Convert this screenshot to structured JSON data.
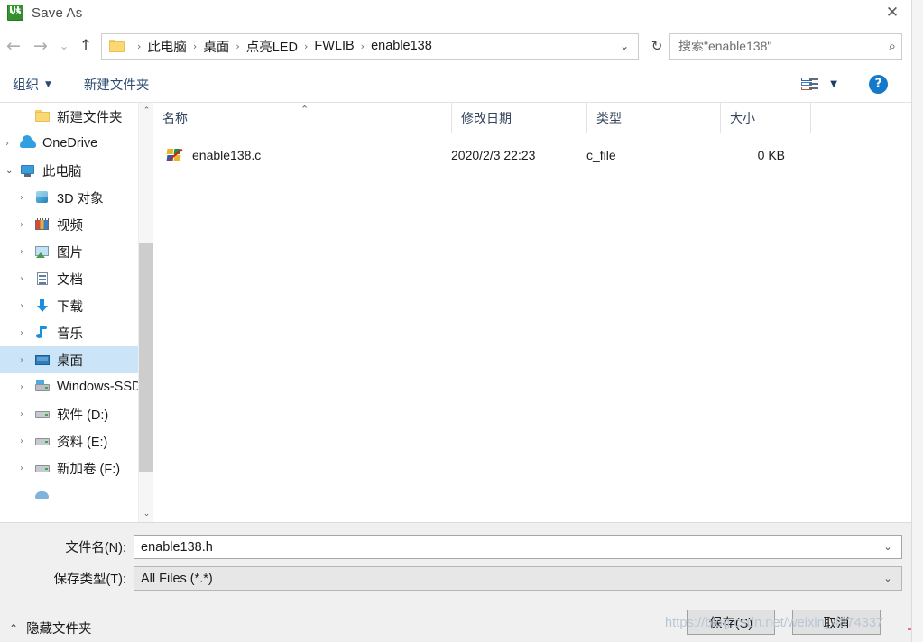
{
  "window": {
    "title": "Save As",
    "app_icon": "keil-uvision5-icon",
    "close_label": "✕"
  },
  "nav": {
    "back_icon": "←",
    "forward_icon": "→",
    "history_icon": "⌄",
    "up_icon": "↑",
    "refresh_icon": "↻",
    "address_chevron": "⌄",
    "breadcrumbs": [
      {
        "label": "此电脑"
      },
      {
        "label": "桌面"
      },
      {
        "label": "点亮LED"
      },
      {
        "label": "FWLIB"
      },
      {
        "label": "enable138"
      }
    ],
    "separator": "›"
  },
  "search": {
    "placeholder": "搜索\"enable138\"",
    "icon": "⌕"
  },
  "toolbar": {
    "organize_label": "组织",
    "organize_caret": "▼",
    "new_folder_label": "新建文件夹",
    "view_caret": "▼",
    "help_label": "?"
  },
  "sidebar": {
    "items": [
      {
        "label": "新建文件夹",
        "chevron": "",
        "icon": "folder-icon",
        "indent": 2,
        "selected": false
      },
      {
        "label": "OneDrive",
        "chevron": "›",
        "icon": "cloud-icon",
        "indent": 1,
        "selected": false
      },
      {
        "label": "此电脑",
        "chevron": "⌄",
        "icon": "pc-icon",
        "indent": 1,
        "selected": false
      },
      {
        "label": "3D 对象",
        "chevron": "›",
        "icon": "3d-objects-icon",
        "indent": 2,
        "selected": false
      },
      {
        "label": "视频",
        "chevron": "›",
        "icon": "video-icon",
        "indent": 2,
        "selected": false
      },
      {
        "label": "图片",
        "chevron": "›",
        "icon": "pictures-icon",
        "indent": 2,
        "selected": false
      },
      {
        "label": "文档",
        "chevron": "›",
        "icon": "documents-icon",
        "indent": 2,
        "selected": false
      },
      {
        "label": "下载",
        "chevron": "›",
        "icon": "downloads-icon",
        "indent": 2,
        "selected": false
      },
      {
        "label": "音乐",
        "chevron": "›",
        "icon": "music-icon",
        "indent": 2,
        "selected": false
      },
      {
        "label": "桌面",
        "chevron": "›",
        "icon": "desktop-icon",
        "indent": 2,
        "selected": true
      },
      {
        "label": "Windows-SSD",
        "chevron": "›",
        "icon": "ssd-drive-icon",
        "indent": 2,
        "selected": false
      },
      {
        "label": "软件 (D:)",
        "chevron": "›",
        "icon": "drive-icon",
        "indent": 2,
        "selected": false
      },
      {
        "label": "资料 (E:)",
        "chevron": "›",
        "icon": "drive-icon",
        "indent": 2,
        "selected": false
      },
      {
        "label": "新加卷 (F:)",
        "chevron": "›",
        "icon": "drive-icon",
        "indent": 2,
        "selected": false
      }
    ],
    "scroll_up_icon": "⌃",
    "scroll_down_icon": "⌄"
  },
  "filelist": {
    "columns": [
      {
        "key": "name",
        "label": "名称"
      },
      {
        "key": "date",
        "label": "修改日期"
      },
      {
        "key": "type",
        "label": "类型"
      },
      {
        "key": "size",
        "label": "大小"
      }
    ],
    "sort_caret": "⌃",
    "rows": [
      {
        "name": "enable138.c",
        "date": "2020/2/3 22:23",
        "type": "c_file",
        "size": "0 KB",
        "icon": "c-source-file-icon"
      }
    ]
  },
  "form": {
    "filename_label": "文件名(N):",
    "filename_value": "enable138.h",
    "filetype_label": "保存类型(T):",
    "filetype_value": "All Files (*.*)",
    "dropdown_icon": "⌄"
  },
  "buttons": {
    "save_label": "保存(S)",
    "cancel_label": "取消"
  },
  "footer": {
    "hide_folders_caret": "⌃",
    "hide_folders_label": "隐藏文件夹"
  },
  "watermark": {
    "text": "https://blog.csdn.net/weixin_4874337"
  },
  "colors": {
    "selection": "#cce4f7",
    "accent": "#1479c9",
    "command_text": "#2b4b72",
    "panel": "#f0f0f0"
  }
}
